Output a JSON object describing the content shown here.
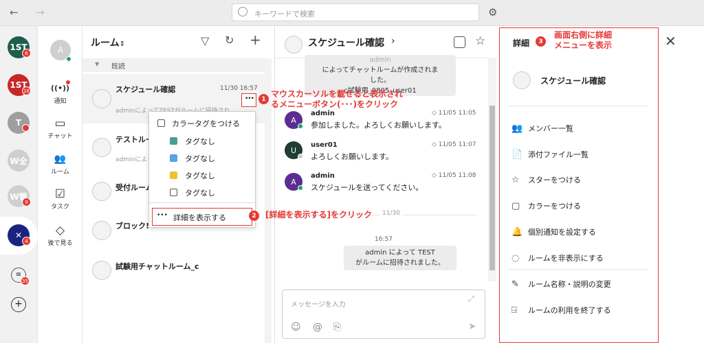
{
  "topbar": {
    "back": "←",
    "forward": "→",
    "search_placeholder": "キーワードで検索",
    "settings_glyph": "⚙"
  },
  "workspaces": [
    {
      "label": "1ST",
      "badge": "6",
      "color": "#1f5d4c"
    },
    {
      "label": "1ST",
      "badge": "16",
      "color": "#c62828"
    },
    {
      "label": "T",
      "badge": "",
      "color": "#9e9e9e"
    },
    {
      "label": "W全",
      "badge": "",
      "color": "#cfcfcf"
    },
    {
      "label": "W管",
      "badge": "9",
      "color": "#cfcfcf"
    },
    {
      "label": "✕",
      "badge": "4",
      "color": "#1a237e"
    }
  ],
  "ws_bottom": {
    "list_badge": "35",
    "add": "+"
  },
  "user": {
    "initial": "A",
    "color": "#cfcfcf"
  },
  "nav": [
    {
      "label": "通知",
      "glyph": "((•))"
    },
    {
      "label": "チャット",
      "glyph": "▭"
    },
    {
      "label": "ルーム",
      "glyph": "👥"
    },
    {
      "label": "タスク",
      "glyph": "☑"
    },
    {
      "label": "後で見る",
      "glyph": "◇"
    }
  ],
  "rooms": {
    "title": "ルーム",
    "sort_glyph": "⇕",
    "group_label": "既読",
    "items": [
      {
        "name": "スケジュール確認",
        "time": "11/30 16:57",
        "sub": "adminによってTESTがルームに招待され..."
      },
      {
        "name": "テストルー",
        "time": "",
        "sub": "adminによっ"
      },
      {
        "name": "受付ルーム",
        "time": "",
        "sub": ""
      },
      {
        "name": "ブロック!",
        "time": "",
        "sub": ""
      },
      {
        "name": "試験用チャットルーム_c",
        "time": "",
        "sub": ""
      }
    ]
  },
  "context_menu": {
    "color_tag": "カラータグをつける",
    "tags": [
      {
        "label": "タグなし",
        "color": "#4a9d8f"
      },
      {
        "label": "タグなし",
        "color": "#5aa2e0"
      },
      {
        "label": "タグなし",
        "color": "#f0c030"
      },
      {
        "label": "タグなし",
        "color": ""
      }
    ],
    "show_detail": "詳細を表示する",
    "dots": "•••"
  },
  "chat": {
    "title": "スケジュール確認",
    "chevron": "›",
    "top_bubble": [
      "admin",
      "によってチャットルームが作成されま",
      "した。",
      "c試験用_0805_user01"
    ],
    "messages": [
      {
        "initial": "A",
        "color": "#5c2d91",
        "name": "admin",
        "time": "11/05 11:05",
        "text": "参加しました。よろしくお願いします。"
      },
      {
        "initial": "U",
        "color": "#1f3d35",
        "name": "user01",
        "time": "11/05 11:07",
        "text": "よろしくお願いします。"
      },
      {
        "initial": "A",
        "color": "#5c2d91",
        "name": "admin",
        "time": "11/05 11:08",
        "text": "スケジュールを送ってください。"
      }
    ],
    "date_divider": "11/30",
    "sys_time": "16:57",
    "sys_bubble": [
      "admin によって TEST",
      "がルームに招待されました。"
    ],
    "input_placeholder": "メッセージを入力"
  },
  "detail": {
    "title": "詳細",
    "room_name": "スケジュール確認",
    "items": [
      {
        "label": "メンバー一覧",
        "glyph": "👥"
      },
      {
        "label": "添付ファイル一覧",
        "glyph": "📄"
      },
      {
        "label": "スターをつける",
        "glyph": "☆"
      },
      {
        "label": "カラーをつける",
        "glyph": "▢"
      },
      {
        "label": "個別通知を設定する",
        "glyph": "🔔"
      },
      {
        "label": "ルームを非表示にする",
        "glyph": "◌"
      },
      {
        "label": "ルーム名称・説明の変更",
        "glyph": "✎"
      },
      {
        "label": "ルームの利用を終了する",
        "glyph": "⍈"
      }
    ]
  },
  "annotations": {
    "n1": "1",
    "t1a": "マウスカーソルを載せると表示され",
    "t1b": "るメニューボタン(･･･)をクリック",
    "n2": "2",
    "t2": "[詳細を表示する]をクリック",
    "n3": "3",
    "t3a": "画面右側に詳細",
    "t3b": "メニューを表示",
    "color": "#e53935"
  }
}
